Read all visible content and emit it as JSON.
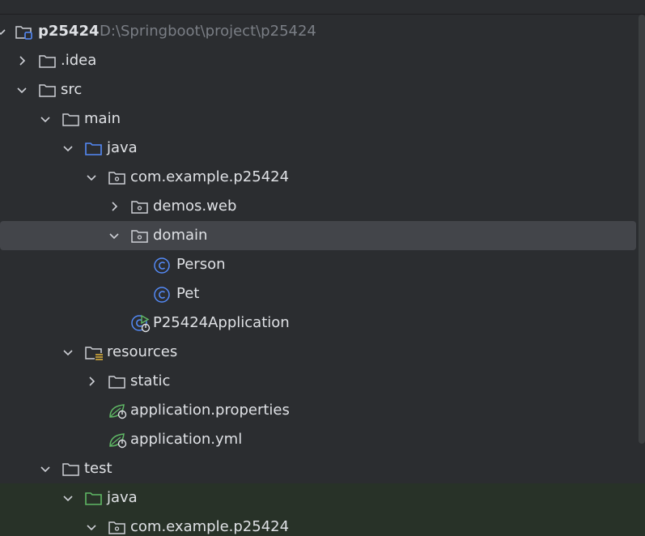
{
  "tree": {
    "root": {
      "label": "p25424",
      "path": "D:\\Springboot\\project\\p25424"
    },
    "idea": {
      "label": ".idea"
    },
    "src": {
      "label": "src"
    },
    "main": {
      "label": "main"
    },
    "java": {
      "label": "java"
    },
    "pkg": {
      "label": "com.example.p25424"
    },
    "demos_web": {
      "label": "demos.web"
    },
    "domain": {
      "label": "domain"
    },
    "person": {
      "label": "Person"
    },
    "pet": {
      "label": "Pet"
    },
    "app": {
      "label": "P25424Application"
    },
    "resources": {
      "label": "resources"
    },
    "static": {
      "label": "static"
    },
    "app_props": {
      "label": "application.properties"
    },
    "app_yml": {
      "label": "application.yml"
    },
    "test": {
      "label": "test"
    },
    "test_java": {
      "label": "java"
    },
    "test_pkg": {
      "label": "com.example.p25424"
    }
  },
  "colors": {
    "background": "#2b2d30",
    "selection": "#43454a",
    "test_background": "#283228",
    "text": "#dfe1e5",
    "path_text": "#7a7e85",
    "source_root_blue": "#548af7",
    "test_root_green": "#5fb865",
    "class_blue": "#548af7",
    "spring_green": "#5fb865"
  }
}
